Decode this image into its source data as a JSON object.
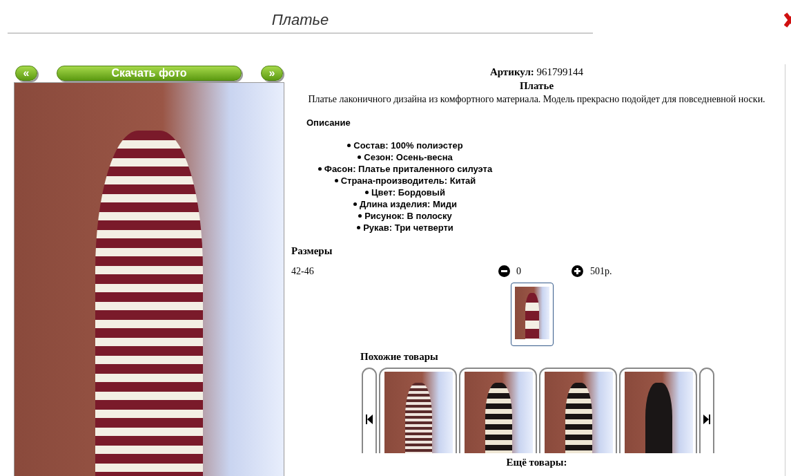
{
  "page_title": "Платье",
  "photo_nav": {
    "prev": "«",
    "download": "Скачать фото",
    "next": "»"
  },
  "product": {
    "article_label": "Артикул:",
    "article": "961799144",
    "name": "Платье",
    "description": "Платье лаконичного дизайна из комфортного материала. Модель прекрасно подойдет для повседневной носки."
  },
  "details": {
    "title": "Описание",
    "items": [
      "Состав: 100% полиэстер",
      "Сезон: Осень-весна",
      "Фасон: Платье приталенного силуэта",
      "Страна-производитель: Китай",
      "Цвет: Бордовый",
      "Длина изделия: Миди",
      "Рисунок: В полоску",
      "Рукав: Три четверти"
    ]
  },
  "sizes": {
    "title": "Размеры",
    "rows": [
      {
        "size": "42-46",
        "quantity": "0",
        "price": "501р."
      }
    ]
  },
  "thumbnails": [
    {
      "selected": true
    }
  ],
  "similar": {
    "title": "Похожие товары",
    "items": [
      {
        "kind": "light-stripes"
      },
      {
        "kind": "bold-stripes"
      },
      {
        "kind": "bold-stripes"
      },
      {
        "kind": "solid"
      }
    ]
  },
  "more_title": "Ещё товары:"
}
